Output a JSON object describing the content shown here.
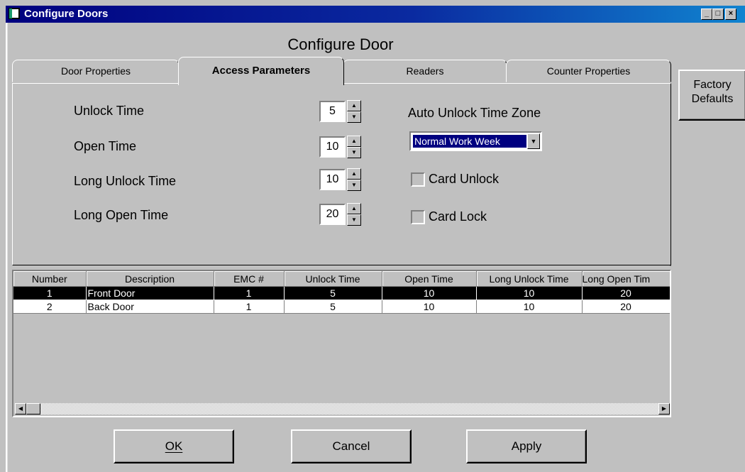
{
  "window": {
    "title": "Configure Doors",
    "buttons": {
      "minimize": "_",
      "maximize": "□",
      "close": "×"
    }
  },
  "dialog": {
    "title": "Configure Door"
  },
  "tabs": [
    {
      "label": "Door Properties",
      "active": false
    },
    {
      "label": "Access Parameters",
      "active": true
    },
    {
      "label": "Readers",
      "active": false
    },
    {
      "label": "Counter Properties",
      "active": false
    }
  ],
  "factory_defaults": {
    "line1": "Factory",
    "line2": "Defaults"
  },
  "params": {
    "unlock_time": {
      "label": "Unlock Time",
      "value": "5"
    },
    "open_time": {
      "label": "Open Time",
      "value": "10"
    },
    "long_unlock_time": {
      "label": "Long Unlock Time",
      "value": "10"
    },
    "long_open_time": {
      "label": "Long Open Time",
      "value": "20"
    }
  },
  "auto_unlock": {
    "label": "Auto Unlock Time Zone",
    "selected": "Normal Work Week"
  },
  "card_unlock": {
    "label": "Card Unlock",
    "checked": false
  },
  "card_lock": {
    "label": "Card Lock",
    "checked": false
  },
  "grid": {
    "columns": [
      "Number",
      "Description",
      "EMC #",
      "Unlock Time",
      "Open Time",
      "Long Unlock Time",
      "Long Open Tim"
    ],
    "rows": [
      [
        "1",
        "Front Door",
        "1",
        "5",
        "10",
        "10",
        "20"
      ],
      [
        "2",
        "Back Door",
        "1",
        "5",
        "10",
        "10",
        "20"
      ]
    ],
    "selected_row": 0
  },
  "buttons": {
    "ok": "OK",
    "cancel": "Cancel",
    "apply": "Apply"
  },
  "colors": {
    "titlebar": "#00007f",
    "face": "#c0c0c0",
    "selection": "#000080"
  },
  "icons": {
    "app": "door-app-icon",
    "spin_up": "arrow-up-icon",
    "spin_down": "arrow-down-icon",
    "dropdown": "chevron-down-icon"
  }
}
